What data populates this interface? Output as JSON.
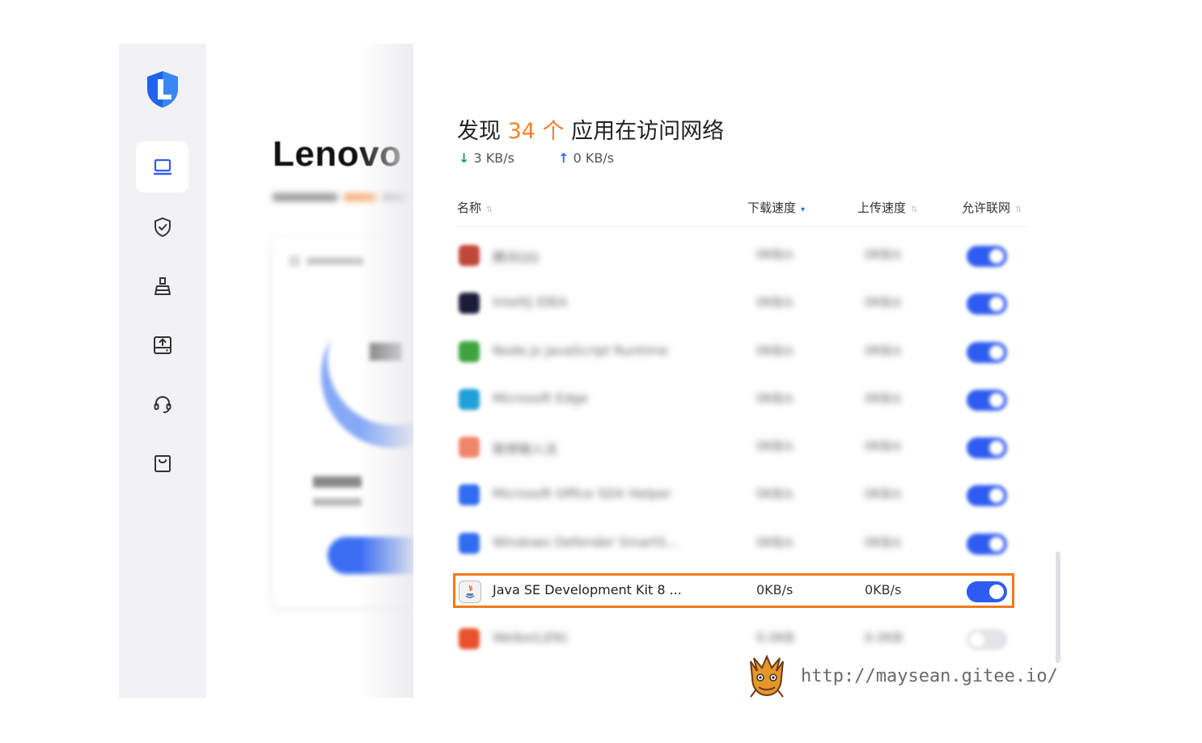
{
  "sidebar": {
    "logo_icon": "lenovo-shield-logo",
    "items": [
      {
        "icon": "laptop-icon",
        "active": true
      },
      {
        "icon": "shield-check-icon",
        "active": false
      },
      {
        "icon": "broom-icon",
        "active": false
      },
      {
        "icon": "disk-upload-icon",
        "active": false
      },
      {
        "icon": "headset-icon",
        "active": false
      },
      {
        "icon": "shopping-bag-icon",
        "active": false
      }
    ]
  },
  "background_panel": {
    "title": "Lenovo"
  },
  "main": {
    "heading_prefix": "发现",
    "heading_count": "34 个",
    "heading_suffix": "应用在访问网络",
    "download_speed": "3 KB/s",
    "upload_speed": "0 KB/s",
    "columns": {
      "name": "名称",
      "download": "下载速度",
      "upload": "上传速度",
      "allow": "允许联网"
    },
    "rows": [
      {
        "name": "腾讯QQ",
        "dl": "0KB/s",
        "ul": "0KB/s",
        "allowed": true,
        "blurred": true,
        "icon_color": "#c0463a"
      },
      {
        "name": "IntelliJ IDEA",
        "dl": "0KB/s",
        "ul": "0KB/s",
        "allowed": true,
        "blurred": true,
        "icon_color": "#1b1b3a"
      },
      {
        "name": "Node.js JavaScript Runtime",
        "dl": "0KB/s",
        "ul": "0KB/s",
        "allowed": true,
        "blurred": true,
        "icon_color": "#3ea33e"
      },
      {
        "name": "Microsoft Edge",
        "dl": "0KB/s",
        "ul": "0KB/s",
        "allowed": true,
        "blurred": true,
        "icon_color": "#1fa0d8"
      },
      {
        "name": "联想输入法",
        "dl": "0KB/s",
        "ul": "0KB/s",
        "allowed": true,
        "blurred": true,
        "icon_color": "#f0856a"
      },
      {
        "name": "Microsoft Office SDX Helper",
        "dl": "0KB/s",
        "ul": "0KB/s",
        "allowed": true,
        "blurred": true,
        "icon_color": "#2f6cf0"
      },
      {
        "name": "Windows Defender SmartS...",
        "dl": "0KB/s",
        "ul": "0KB/s",
        "allowed": true,
        "blurred": true,
        "icon_color": "#2f6cf0"
      },
      {
        "name": "Java SE Development Kit 8 ...",
        "dl": "0KB/s",
        "ul": "0KB/s",
        "allowed": true,
        "blurred": false,
        "icon_color": "#f2f2f2"
      },
      {
        "name": "Weibo(LEN)",
        "dl": "0.0KB",
        "ul": "0.0KB",
        "allowed": false,
        "blurred": true,
        "icon_color": "#e8512c"
      }
    ]
  },
  "watermark": {
    "url": "http://maysean.gitee.io/",
    "icon": "dragon-head-icon"
  },
  "colors": {
    "accent_orange": "#f6802b",
    "toggle_blue": "#2f5cf0",
    "highlight_border": "#f07a1c",
    "download_arrow": "#1aa55a",
    "upload_arrow": "#2f6cf0"
  }
}
